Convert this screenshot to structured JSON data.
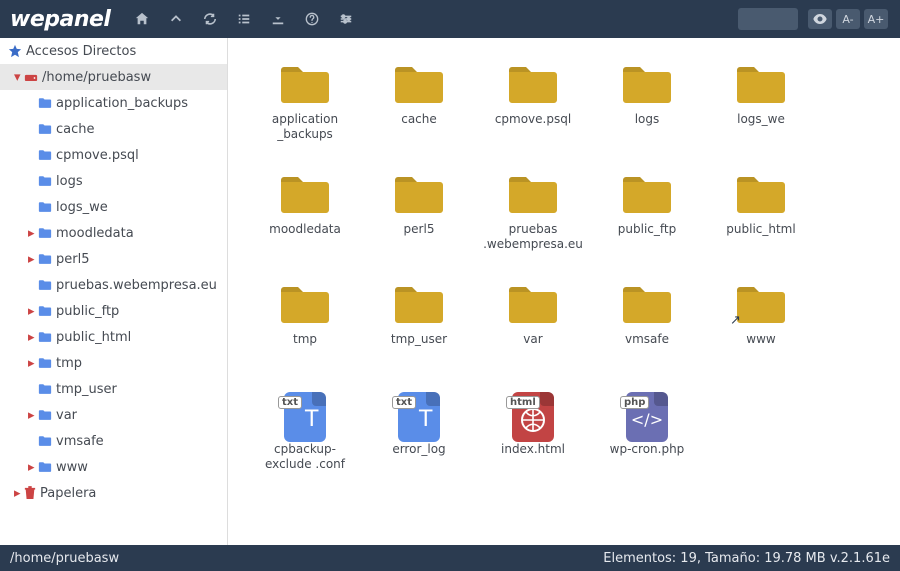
{
  "logo": "wepanel",
  "search": {
    "placeholder": ""
  },
  "font_buttons": {
    "eye": "👁",
    "minus": "A-",
    "plus": "A+"
  },
  "sidebar": {
    "shortcuts_label": "Accesos Directos",
    "root_label": "/home/pruebasw",
    "trash_label": "Papelera",
    "items": [
      {
        "label": "application_backups",
        "expandable": false,
        "level": 2
      },
      {
        "label": "cache",
        "expandable": false,
        "level": 2
      },
      {
        "label": "cpmove.psql",
        "expandable": false,
        "level": 2
      },
      {
        "label": "logs",
        "expandable": false,
        "level": 2
      },
      {
        "label": "logs_we",
        "expandable": false,
        "level": 2
      },
      {
        "label": "moodledata",
        "expandable": true,
        "level": 2
      },
      {
        "label": "perl5",
        "expandable": true,
        "level": 2
      },
      {
        "label": "pruebas.webempresa.eu",
        "expandable": false,
        "level": 2
      },
      {
        "label": "public_ftp",
        "expandable": true,
        "level": 2
      },
      {
        "label": "public_html",
        "expandable": true,
        "level": 2
      },
      {
        "label": "tmp",
        "expandable": true,
        "level": 2
      },
      {
        "label": "tmp_user",
        "expandable": false,
        "level": 2
      },
      {
        "label": "var",
        "expandable": true,
        "level": 2
      },
      {
        "label": "vmsafe",
        "expandable": false,
        "level": 2
      },
      {
        "label": "www",
        "expandable": true,
        "level": 2
      }
    ]
  },
  "items": [
    {
      "name": "application_backups",
      "type": "folder"
    },
    {
      "name": "cache",
      "type": "folder"
    },
    {
      "name": "cpmove.psql",
      "type": "folder"
    },
    {
      "name": "logs",
      "type": "folder"
    },
    {
      "name": "logs_we",
      "type": "folder"
    },
    {
      "name": "moodledata",
      "type": "folder"
    },
    {
      "name": "perl5",
      "type": "folder"
    },
    {
      "name": "pruebas.webempresa.eu",
      "type": "folder"
    },
    {
      "name": "public_ftp",
      "type": "folder"
    },
    {
      "name": "public_html",
      "type": "folder"
    },
    {
      "name": "tmp",
      "type": "folder"
    },
    {
      "name": "tmp_user",
      "type": "folder"
    },
    {
      "name": "var",
      "type": "folder"
    },
    {
      "name": "vmsafe",
      "type": "folder"
    },
    {
      "name": "www",
      "type": "folder",
      "link": true
    },
    {
      "name": "cpbackup-exclude.conf",
      "type": "file",
      "badge": "txt",
      "color": "#5a8de8",
      "glyph": "T"
    },
    {
      "name": "error_log",
      "type": "file",
      "badge": "txt",
      "color": "#5a8de8",
      "glyph": "T"
    },
    {
      "name": "index.html",
      "type": "file",
      "badge": "html",
      "color": "#c24444",
      "glyph": "globe"
    },
    {
      "name": "wp-cron.php",
      "type": "file",
      "badge": "php",
      "color": "#6b6fb3",
      "glyph": "code"
    }
  ],
  "footer": {
    "path": "/home/pruebasw",
    "status": "Elementos: 19, Tamaño: 19.78 MB v.2.1.61e"
  },
  "colors": {
    "folder": "#d4a829",
    "header": "#2b3b50"
  }
}
